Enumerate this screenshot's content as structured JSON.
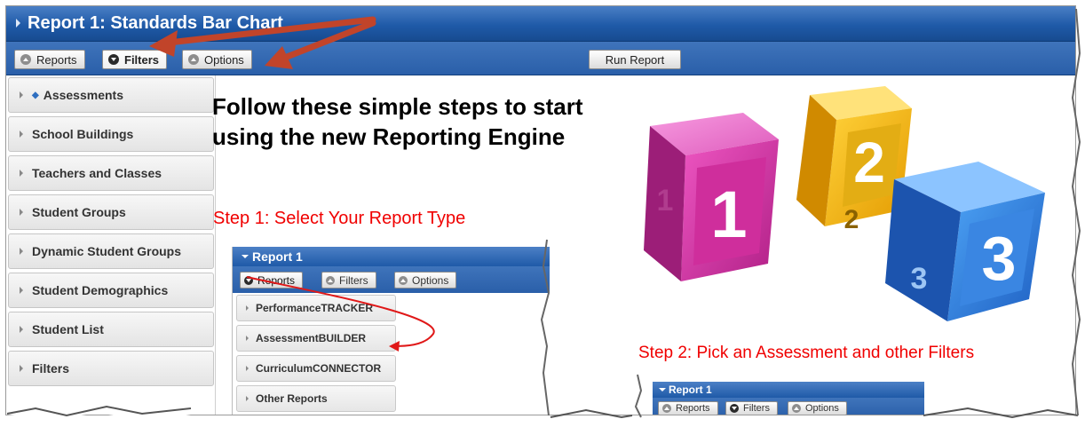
{
  "window": {
    "title": "Report 1: Standards Bar Chart"
  },
  "toolbar": {
    "reports_label": "Reports",
    "filters_label": "Filters",
    "options_label": "Options",
    "run_label": "Run Report"
  },
  "sidebar": {
    "items": [
      {
        "label": "Assessments"
      },
      {
        "label": "School Buildings"
      },
      {
        "label": "Teachers and Classes"
      },
      {
        "label": "Student Groups"
      },
      {
        "label": "Dynamic Student Groups"
      },
      {
        "label": "Student Demographics"
      },
      {
        "label": "Student List"
      },
      {
        "label": "Filters"
      }
    ]
  },
  "main": {
    "heading": "Follow these simple steps to start using the new Reporting Engine",
    "step1": "Step 1:  Select Your Report Type",
    "step2": "Step 2:  Pick an Assessment and other Filters",
    "cube_numbers": [
      "1",
      "2",
      "3"
    ]
  },
  "mini1": {
    "title": "Report 1",
    "reports_label": "Reports",
    "filters_label": "Filters",
    "options_label": "Options",
    "items": [
      "PerformanceTRACKER",
      "AssessmentBUILDER",
      "CurriculumCONNECTOR",
      "Other Reports"
    ]
  },
  "mini2": {
    "title": "Report 1",
    "reports_label": "Reports",
    "filters_label": "Filters",
    "options_label": "Options"
  },
  "colors": {
    "titlebar": "#1f5aa8",
    "annotation_red": "#f00000",
    "arrow": "#c1442a",
    "cube_pink": "#d63aa8",
    "cube_yellow": "#f2b400",
    "cube_blue": "#2f7be0"
  }
}
